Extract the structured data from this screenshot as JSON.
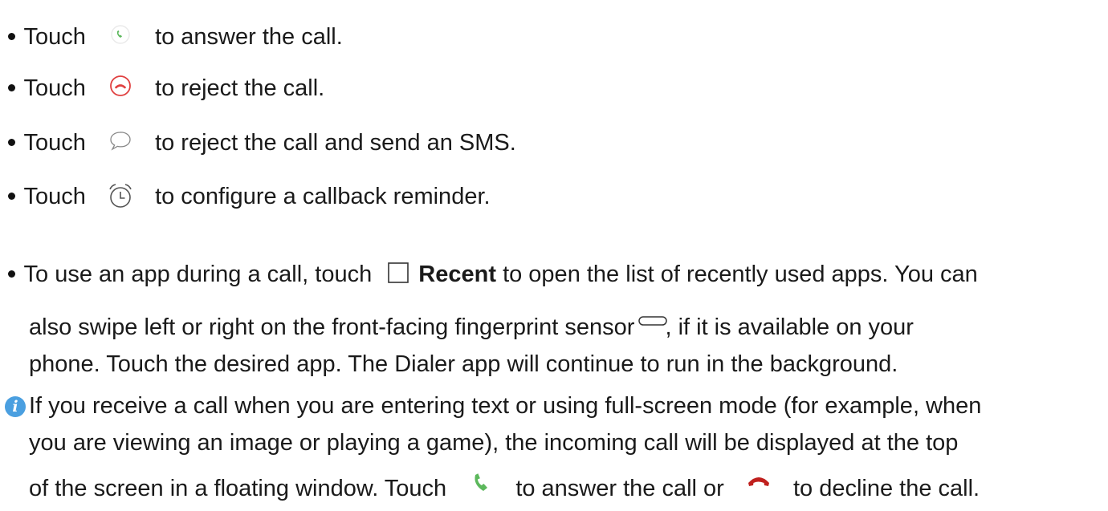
{
  "items": [
    {
      "lead": "Touch",
      "icon": "answer-icon",
      "text": "to answer the call."
    },
    {
      "lead": "Touch",
      "icon": "reject-icon",
      "text": "to reject the call."
    },
    {
      "lead": "Touch",
      "icon": "message-icon",
      "text": "to reject the call and send an SMS."
    },
    {
      "lead": "Touch",
      "icon": "alarm-clock-icon",
      "text": "to configure a callback reminder."
    }
  ],
  "recent": {
    "lead": "To use an app during a call, touch",
    "bold": "Recent",
    "rest": "to open the list of recently used apps. You can",
    "line2a": "also swipe left or right on the front-facing fingerprint sensor",
    "line2b": ", if it is available on your",
    "line3": "phone. Touch the desired app. The Dialer app will continue to run in the background."
  },
  "note": {
    "icon": "info-icon",
    "line1": "If you receive a call when you are entering text or using full-screen mode (for example, when",
    "line2": "you are viewing an image or playing a game), the incoming call will be displayed at the top",
    "line3a": "of the screen in a floating window. Touch",
    "line3b": "to answer the call or",
    "line3c": "to decline the call."
  },
  "colors": {
    "answer": "#5cb85c",
    "reject": "#e04040",
    "decline": "#c0201e",
    "info": "#4a9fe0"
  }
}
